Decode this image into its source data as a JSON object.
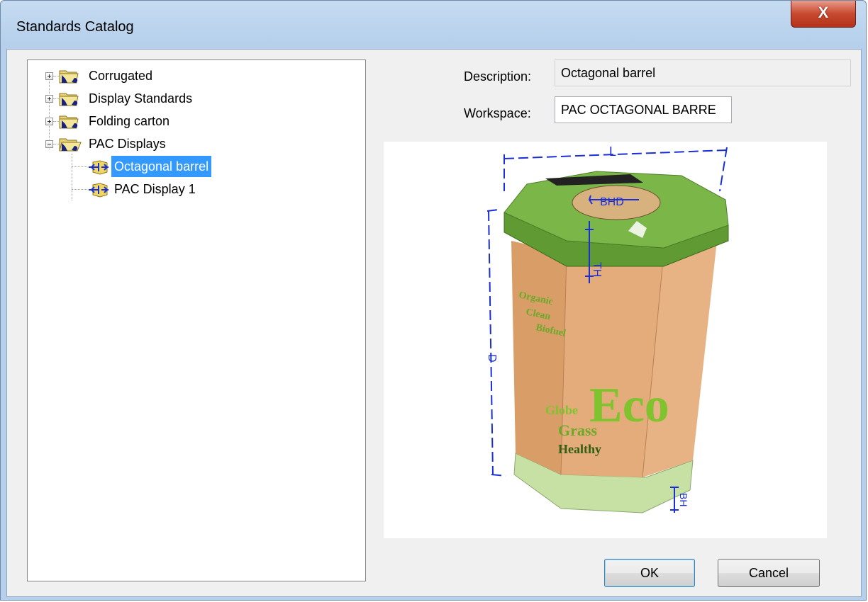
{
  "window": {
    "title": "Standards Catalog",
    "close_label": "X"
  },
  "tree": {
    "items": [
      {
        "label": "Corrugated",
        "expanded": false
      },
      {
        "label": "Display Standards",
        "expanded": false
      },
      {
        "label": "Folding carton",
        "expanded": false
      },
      {
        "label": "PAC Displays",
        "expanded": true,
        "children": [
          {
            "label": "Octagonal barrel",
            "selected": true
          },
          {
            "label": "PAC Display 1",
            "selected": false
          }
        ]
      }
    ]
  },
  "form": {
    "description_label": "Description:",
    "description_value": "Octagonal barrel",
    "workspace_label": "Workspace:",
    "workspace_value": "PAC OCTAGONAL BARRE"
  },
  "preview": {
    "dimension_labels": {
      "length": "L",
      "bottom_hole": "BHD",
      "top_height": "TH",
      "depth": "D",
      "base_height": "BH"
    },
    "artwork_text": {
      "brand": "Eco",
      "word1": "Globe",
      "word2": "Grass",
      "word3": "Healthy",
      "word4": "Organic",
      "word5": "Clean",
      "word6": "Biofuel"
    },
    "colors": {
      "lid": "#7ab648",
      "body": "#e1a775",
      "base": "#c7e0a4",
      "dimension": "#1a2fd6"
    }
  },
  "buttons": {
    "ok": "OK",
    "cancel": "Cancel"
  }
}
